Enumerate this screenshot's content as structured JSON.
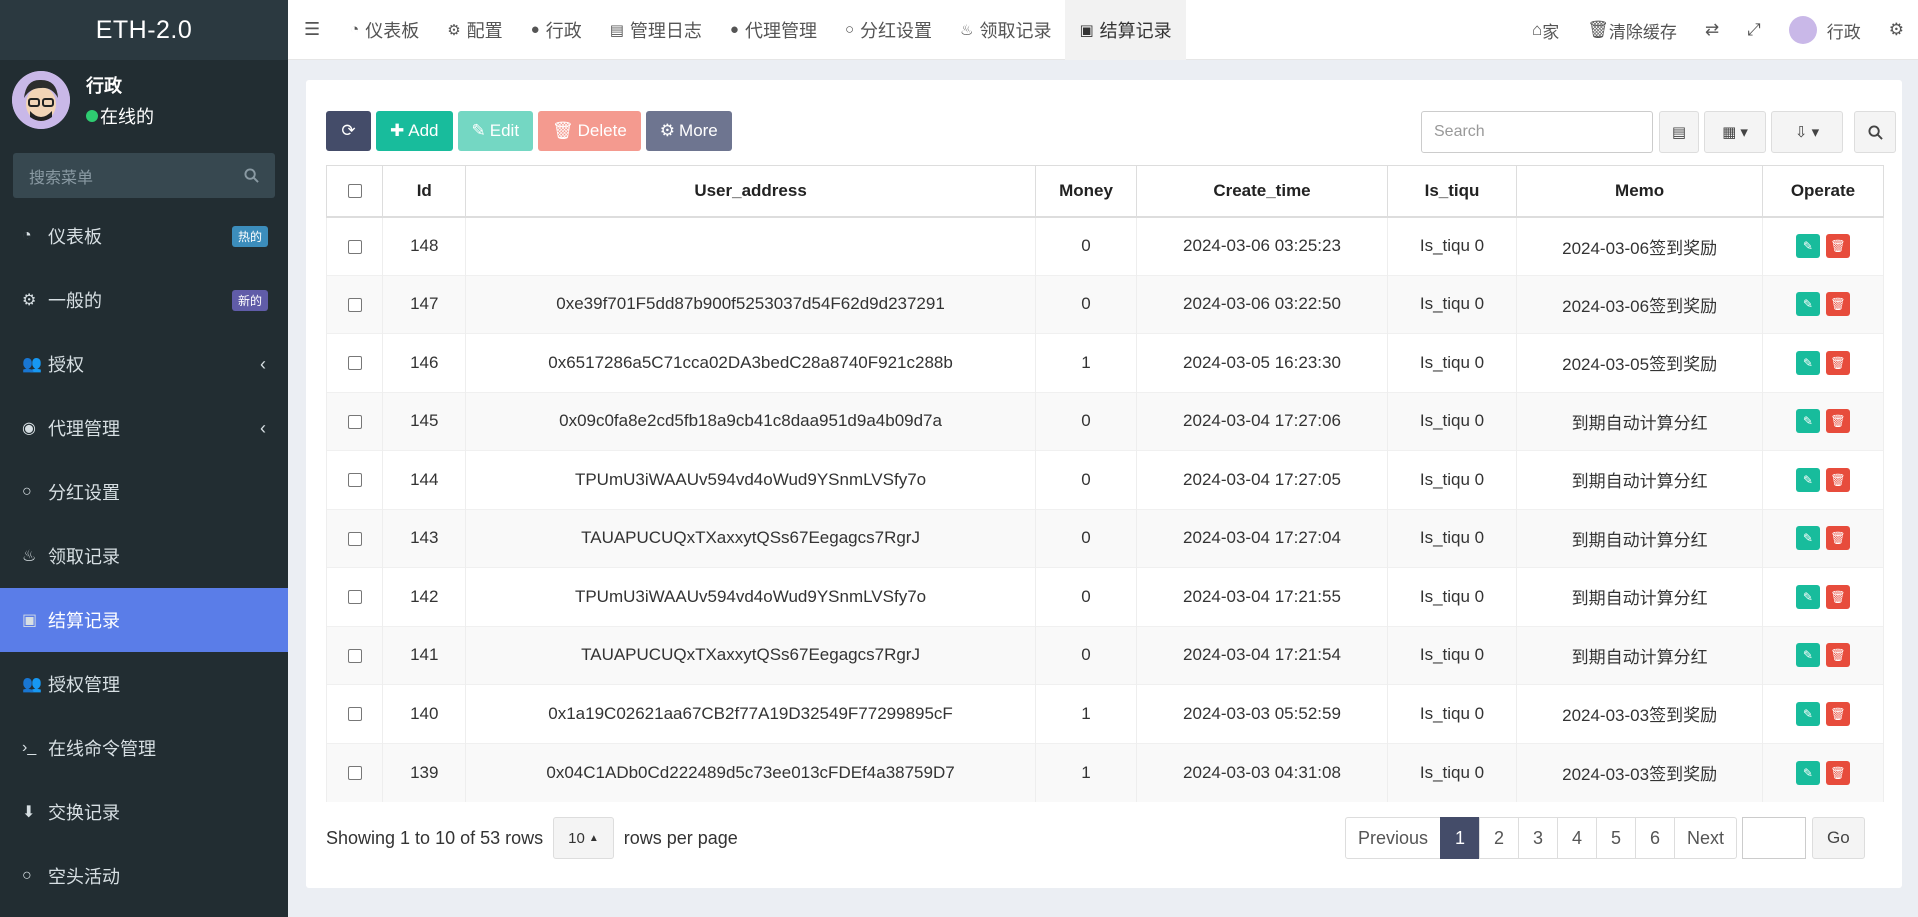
{
  "app": {
    "title": "ETH-2.0"
  },
  "user": {
    "name": "行政",
    "status": "在线的"
  },
  "sidebar": {
    "search_placeholder": "搜索菜单",
    "items": [
      {
        "label": "仪表板",
        "icon": "dashboard-icon",
        "badge": "热的",
        "badge_color": "#3c8dbc"
      },
      {
        "label": "一般的",
        "icon": "cogs-icon",
        "badge": "新的",
        "badge_color": "#605ca8"
      },
      {
        "label": "授权",
        "icon": "group-icon",
        "caret": "‹"
      },
      {
        "label": "代理管理",
        "icon": "user-circle-icon",
        "caret": "‹"
      },
      {
        "label": "分红设置",
        "icon": "circle-icon"
      },
      {
        "label": "领取记录",
        "icon": "cake-icon"
      },
      {
        "label": "结算记录",
        "icon": "cs-icon",
        "active": true
      },
      {
        "label": "授权管理",
        "icon": "group-icon"
      },
      {
        "label": "在线命令管理",
        "icon": "terminal-icon"
      },
      {
        "label": "交换记录",
        "icon": "download-icon"
      },
      {
        "label": "空头活动",
        "icon": "circle-icon"
      }
    ]
  },
  "tabs": [
    {
      "label": "仪表板",
      "icon": "dashboard-icon"
    },
    {
      "label": "配置",
      "icon": "gear-icon"
    },
    {
      "label": "行政",
      "icon": "user-icon"
    },
    {
      "label": "管理日志",
      "icon": "list-icon"
    },
    {
      "label": "代理管理",
      "icon": "user-icon"
    },
    {
      "label": "分红设置",
      "icon": "circle-icon"
    },
    {
      "label": "领取记录",
      "icon": "cake-icon"
    },
    {
      "label": "结算记录",
      "icon": "cs-icon",
      "active": true
    }
  ],
  "topright": {
    "home": "家",
    "clear_cache": "清除缓存",
    "user": "行政"
  },
  "toolbar": {
    "add": "Add",
    "edit": "Edit",
    "delete": "Delete",
    "more": "More",
    "search_placeholder": "Search"
  },
  "table": {
    "columns": [
      "Id",
      "User_address",
      "Money",
      "Create_time",
      "Is_tiqu",
      "Memo",
      "Operate"
    ],
    "rows": [
      {
        "id": "148",
        "addr": "",
        "money": "0",
        "time": "2024-03-06 03:25:23",
        "tiqu": "Is_tiqu 0",
        "memo": "2024-03-06签到奖励"
      },
      {
        "id": "147",
        "addr": "0xe39f701F5dd87b900f5253037d54F62d9d237291",
        "money": "0",
        "time": "2024-03-06 03:22:50",
        "tiqu": "Is_tiqu 0",
        "memo": "2024-03-06签到奖励"
      },
      {
        "id": "146",
        "addr": "0x6517286a5C71cca02DA3bedC28a8740F921c288b",
        "money": "1",
        "time": "2024-03-05 16:23:30",
        "tiqu": "Is_tiqu 0",
        "memo": "2024-03-05签到奖励"
      },
      {
        "id": "145",
        "addr": "0x09c0fa8e2cd5fb18a9cb41c8daa951d9a4b09d7a",
        "money": "0",
        "time": "2024-03-04 17:27:06",
        "tiqu": "Is_tiqu 0",
        "memo": "到期自动计算分红"
      },
      {
        "id": "144",
        "addr": "TPUmU3iWAAUv594vd4oWud9YSnmLVSfy7o",
        "money": "0",
        "time": "2024-03-04 17:27:05",
        "tiqu": "Is_tiqu 0",
        "memo": "到期自动计算分红"
      },
      {
        "id": "143",
        "addr": "TAUAPUCUQxTXaxxytQSs67Eegagcs7RgrJ",
        "money": "0",
        "time": "2024-03-04 17:27:04",
        "tiqu": "Is_tiqu 0",
        "memo": "到期自动计算分红"
      },
      {
        "id": "142",
        "addr": "TPUmU3iWAAUv594vd4oWud9YSnmLVSfy7o",
        "money": "0",
        "time": "2024-03-04 17:21:55",
        "tiqu": "Is_tiqu 0",
        "memo": "到期自动计算分红"
      },
      {
        "id": "141",
        "addr": "TAUAPUCUQxTXaxxytQSs67Eegagcs7RgrJ",
        "money": "0",
        "time": "2024-03-04 17:21:54",
        "tiqu": "Is_tiqu 0",
        "memo": "到期自动计算分红"
      },
      {
        "id": "140",
        "addr": "0x1a19C02621aa67CB2f77A19D32549F77299895cF",
        "money": "1",
        "time": "2024-03-03 05:52:59",
        "tiqu": "Is_tiqu 0",
        "memo": "2024-03-03签到奖励"
      },
      {
        "id": "139",
        "addr": "0x04C1ADb0Cd222489d5c73ee013cFDEf4a38759D7",
        "money": "1",
        "time": "2024-03-03 04:31:08",
        "tiqu": "Is_tiqu 0",
        "memo": "2024-03-03签到奖励"
      }
    ]
  },
  "footer": {
    "showing": "Showing 1 to 10 of 53 rows",
    "page_size": "10",
    "rows_per_page": "rows per page"
  },
  "pagination": {
    "previous": "Previous",
    "pages": [
      "1",
      "2",
      "3",
      "4",
      "5",
      "6"
    ],
    "next": "Next",
    "go": "Go",
    "active": "1"
  }
}
